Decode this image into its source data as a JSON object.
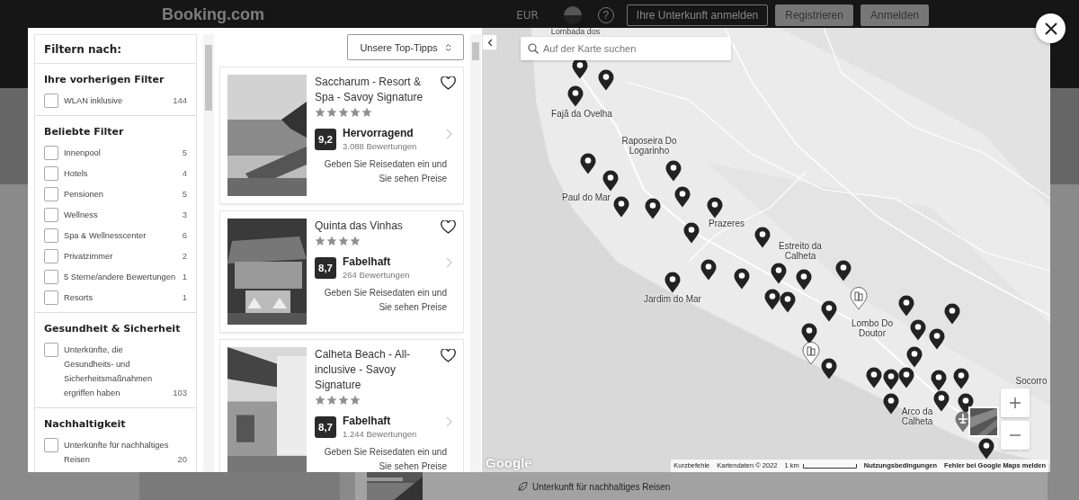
{
  "header": {
    "logo": "Booking.com",
    "currency": "EUR",
    "help": "?",
    "buttons": [
      {
        "label": "Ihre Unterkunft anmelden",
        "kind": "outline"
      },
      {
        "label": "Registrieren",
        "kind": "filled"
      },
      {
        "label": "Anmelden",
        "kind": "filled"
      }
    ]
  },
  "page_behind": {
    "feature": "Unterkunft für nachhaltiges Reisen"
  },
  "filters": {
    "title": "Filtern nach:",
    "groups": [
      {
        "title": "Ihre vorherigen Filter",
        "options": [
          {
            "label": "WLAN inklusive",
            "count": "144",
            "checked": false
          }
        ]
      },
      {
        "title": "Beliebte Filter",
        "options": [
          {
            "label": "Innenpool",
            "count": "5",
            "checked": false
          },
          {
            "label": "Hotels",
            "count": "4",
            "checked": false
          },
          {
            "label": "Pensionen",
            "count": "5",
            "checked": false
          },
          {
            "label": "Wellness",
            "count": "3",
            "checked": false
          },
          {
            "label": "Spa & Wellnesscenter",
            "count": "6",
            "checked": false
          },
          {
            "label": "Privatzimmer",
            "count": "2",
            "checked": false
          },
          {
            "label": "5 Sterne/andere Bewertungen",
            "count": "1",
            "checked": false
          },
          {
            "label": "Resorts",
            "count": "1",
            "checked": false
          }
        ]
      },
      {
        "title": "Gesundheit & Sicherheit",
        "options": [
          {
            "label": "Unterkünfte, die Gesundheits- und Sicherheitsmaßnahmen ergriffen haben",
            "count": "103",
            "checked": false
          }
        ]
      },
      {
        "title": "Nachhaltigkeit",
        "options": [
          {
            "label": "Unterkünfte für nachhaltiges Reisen",
            "count": "20",
            "checked": false
          }
        ]
      }
    ]
  },
  "sort": {
    "label": "Unsere Top-Tipps"
  },
  "properties": [
    {
      "name": "Saccharum - Resort & Spa - Savoy Signature",
      "stars": 5,
      "score": "9,2",
      "rating": "Hervorragend",
      "reviews": "3.088 Bewertungen",
      "price_note": "Geben Sie Reisedaten ein und Sie sehen Preise",
      "saved": false
    },
    {
      "name": "Quinta das Vinhas",
      "stars": 4,
      "score": "8,7",
      "rating": "Fabelhaft",
      "reviews": "264 Bewertungen",
      "price_note": "Geben Sie Reisedaten ein und Sie sehen Preise",
      "saved": false
    },
    {
      "name": "Calheta Beach - All-inclusive - Savoy Signature",
      "stars": 4,
      "score": "8,7",
      "rating": "Fabelhaft",
      "reviews": "1.244 Bewertungen",
      "price_note": "Geben Sie Reisedaten ein und Sie sehen Preise",
      "saved": false
    }
  ],
  "map": {
    "search": {
      "placeholder": "Auf der Karte suchen"
    },
    "places": [
      "Lombada dos",
      "Fajã da Ovelha",
      "Raposeira Do Logarinho",
      "Paul do Mar",
      "Prazeres",
      "Jardim do Mar",
      "Estreito da Calheta",
      "Lombo Do Doutor",
      "Arco da Calheta",
      "Socorro"
    ],
    "logo": "Google",
    "footer": {
      "shortcuts": "Kurzbefehle",
      "data": "Kartendaten © 2022",
      "scale": "1 km",
      "terms": "Nutzungsbedingungen",
      "report": "Fehler bei Google Maps melden"
    }
  }
}
